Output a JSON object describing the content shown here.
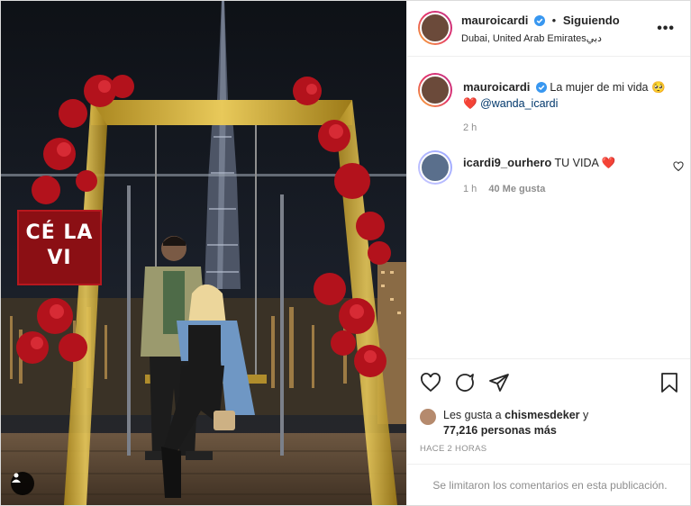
{
  "post": {
    "photo_alt": "",
    "sign_text_line1": "CÉ LA",
    "sign_text_line2": "VI"
  },
  "header": {
    "username": "mauroicardi",
    "separator": "•",
    "follow_status": "Siguiendo",
    "location": "Dubai, United Arab Emiratesدبي",
    "more_label": "•••"
  },
  "caption": {
    "username": "mauroicardi",
    "text": "La mujer de mi vida",
    "emoji": "🥺",
    "heart": "❤️",
    "mention": "@wanda_icardi",
    "time": "2 h"
  },
  "comment": {
    "username": "icardi9_ourhero",
    "text": "TU VIDA",
    "heart": "❤️",
    "time": "1 h",
    "likes": "40 Me gusta"
  },
  "likes": {
    "prefix": "Les gusta a",
    "user": "chismesdeker",
    "conj": "y",
    "count": "77,216 personas más"
  },
  "post_time": "HACE 2 HORAS",
  "comments_disabled": "Se limitaron los comentarios en esta publicación.",
  "colors": {
    "accent_link": "#00376b",
    "verified": "#3897f0",
    "like_red": "#e0245e",
    "muted": "#8e8e8e"
  },
  "icons": [
    "verified-badge-icon",
    "more-options-icon",
    "heart-icon",
    "comment-icon",
    "share-icon",
    "bookmark-icon",
    "user-tag-icon"
  ]
}
